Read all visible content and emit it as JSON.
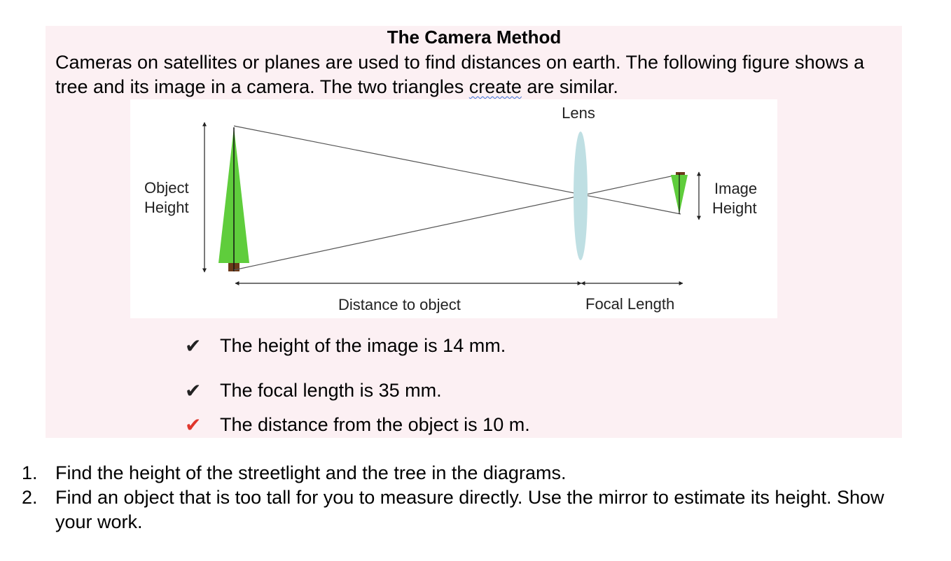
{
  "title": "The Camera Method",
  "intro": {
    "before": "Cameras on satellites or planes are used to find distances on earth.  The following figure shows a tree and its image in a camera. The two triangles ",
    "flagged_word": "create",
    "after": " are similar."
  },
  "figure": {
    "lens_label": "Lens",
    "object_height_line1": "Object",
    "object_height_line2": "Height",
    "image_height_line1": "Image",
    "image_height_line2": "Height",
    "distance_label": "Distance to object",
    "focal_label": "Focal Length",
    "colors": {
      "tree": "#5fcd3c",
      "trunk": "#6b3a1a",
      "lens": "#bfdfe3"
    }
  },
  "checklist": [
    {
      "mark": "✔",
      "color": "#222222",
      "text": "The height of the image is 14 mm."
    },
    {
      "mark": "✔",
      "color": "#222222",
      "text": "The focal length is 35 mm."
    },
    {
      "mark": "✔",
      "color": "#e0362c",
      "text": "The distance from the object is 10 m."
    }
  ],
  "questions": [
    {
      "num": "1.",
      "text": "Find the height of the streetlight and the tree in the diagrams."
    },
    {
      "num": "2.",
      "text": "Find an object that is too tall for you to measure directly. Use the mirror to estimate its height. Show your work."
    }
  ]
}
